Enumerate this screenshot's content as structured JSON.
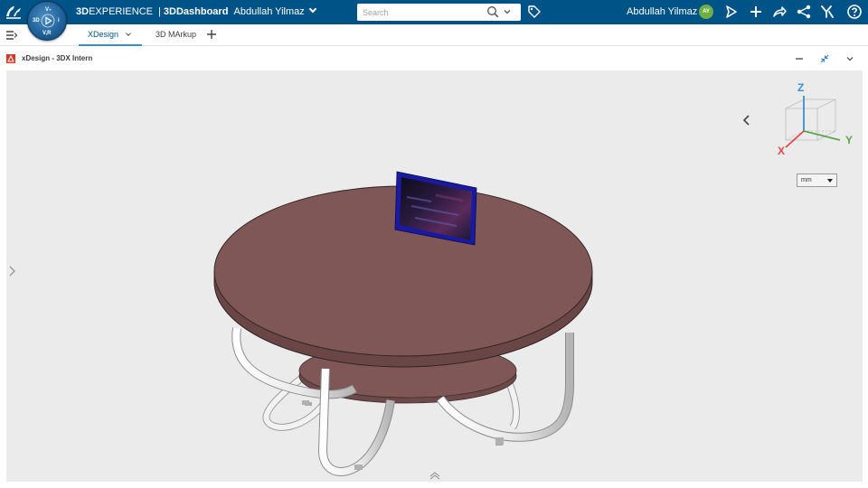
{
  "topbar": {
    "brand_bold": "3D",
    "brand_rest": "EXPERIENCE",
    "brand_separator": "|",
    "app_name": "3DDashboard",
    "dashboard_owner": "Abdullah Yilmaz",
    "compass": {
      "top": "V₊",
      "left": "3D",
      "right": "i",
      "bottom": "V,R"
    },
    "search_placeholder": "Search",
    "user_name": "Abdullah Yilmaz",
    "avatar_initials": "AY",
    "colors": {
      "bar": "#005386",
      "avatar": "#6cb044"
    },
    "icons": [
      "share-icon",
      "add-icon",
      "forward-icon",
      "network-icon",
      "tools-icon",
      "help-icon"
    ]
  },
  "tabs": [
    {
      "label": "XDesign",
      "active": true
    },
    {
      "label": "3D MArkup",
      "active": false
    }
  ],
  "widget": {
    "title": "xDesign - 3DX Intern"
  },
  "viewport": {
    "axes": {
      "x": "X",
      "y": "Y",
      "z": "Z"
    },
    "axis_colors": {
      "x": "#e04848",
      "y": "#5aa64a",
      "z": "#3c8fd0"
    },
    "unit": "mm",
    "model": {
      "table_top_color": "#7f5757",
      "frame_color": "#f2f2f2",
      "frame_color_shadow": "#b9b9b9",
      "screen_border_color": "#1a1aa0"
    }
  }
}
